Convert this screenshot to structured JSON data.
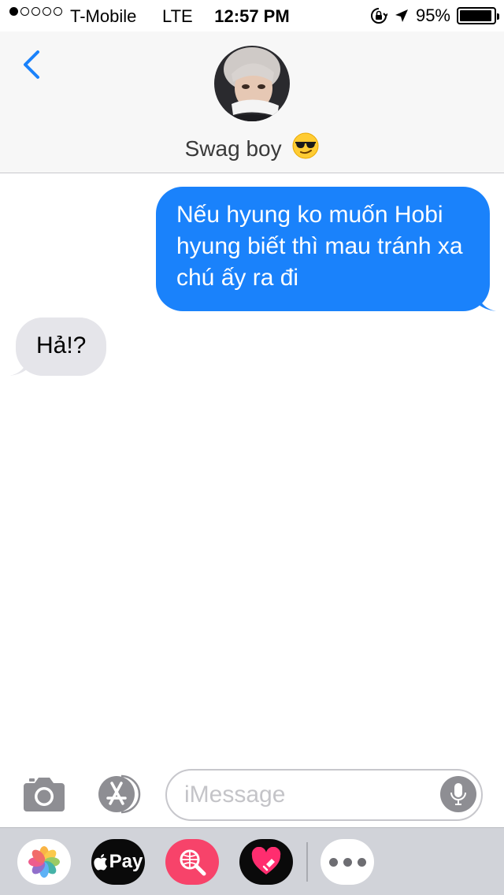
{
  "status_bar": {
    "carrier": "T-Mobile",
    "network": "LTE",
    "time": "12:57 PM",
    "battery_percent": "95%",
    "battery_level": 0.95,
    "signal_bars_filled": 1,
    "signal_bars_total": 5,
    "icons": [
      "orientation-lock-icon",
      "location-arrow-icon",
      "battery-icon"
    ]
  },
  "header": {
    "back_icon": "chevron-left-icon",
    "contact_name": "Swag boy",
    "contact_emoji": "smiling-face-with-sunglasses-emoji",
    "avatar": "contact-avatar-photo"
  },
  "messages": [
    {
      "direction": "outgoing",
      "text": "Nếu hyung ko muốn Hobi hyung biết thì mau tránh xa chú ấy ra đi"
    },
    {
      "direction": "incoming",
      "text": "Hả!?"
    }
  ],
  "input": {
    "placeholder": "iMessage",
    "value": "",
    "left_buttons": [
      "camera-icon",
      "app-store-icon"
    ],
    "right_button": "microphone-icon"
  },
  "app_drawer": {
    "apps": [
      {
        "name": "photos",
        "icon": "photos-icon"
      },
      {
        "name": "apple-pay",
        "icon": "apple-pay-icon",
        "label": "Pay"
      },
      {
        "name": "image-search",
        "icon": "globe-search-icon"
      },
      {
        "name": "digital-touch",
        "icon": "heart-touch-icon"
      },
      {
        "name": "more",
        "icon": "more-dots-icon"
      }
    ]
  },
  "colors": {
    "ios_blue": "#1a82fb",
    "incoming_bubble": "#e5e5ea",
    "drawer_bg": "#d1d3d9",
    "search_app_pink": "#f7436a"
  }
}
